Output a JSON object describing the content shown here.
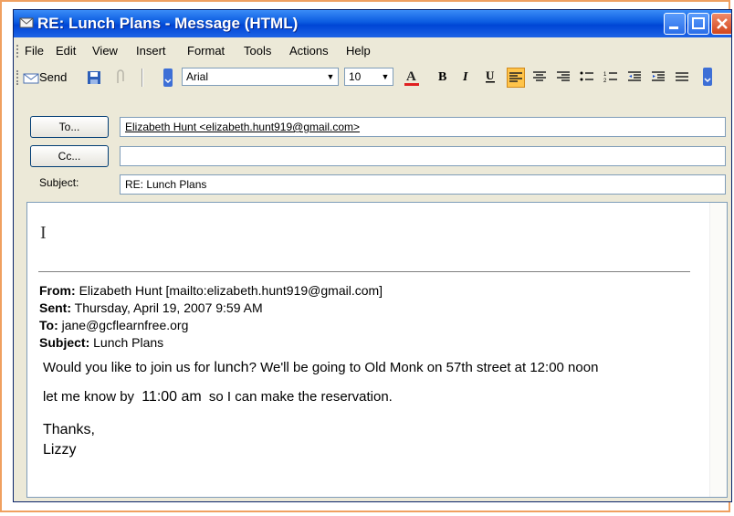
{
  "window": {
    "title": "RE: Lunch Plans - Message (HTML)"
  },
  "menu": [
    "File",
    "Edit",
    "View",
    "Insert",
    "Format",
    "Tools",
    "Actions",
    "Help"
  ],
  "toolbar": {
    "send_label": "Send",
    "font": "Arial",
    "size": "10"
  },
  "fields": {
    "to_button": "To...",
    "cc_button": "Cc...",
    "subject_label": "Subject:",
    "to_value": "Elizabeth Hunt <elizabeth.hunt919@gmail.com>",
    "cc_value": "",
    "subject_value": "RE: Lunch Plans"
  },
  "quoted": {
    "from_label": "From:",
    "from_value": "Elizabeth Hunt [mailto:elizabeth.hunt919@gmail.com]",
    "sent_label": "Sent:",
    "sent_value": "Thursday, April 19, 2007 9:59 AM",
    "to_label": "To:",
    "to_value": "jane@gcflearnfree.org",
    "subject_label": "Subject:",
    "subject_value": "Lunch Plans"
  },
  "message": {
    "line1_a": "Would you like to join us for",
    "line1_b": "lunch",
    "line1_c": "? We'll be going to Old Monk on 57th street at 12:00 noon",
    "line2_a": "let me know by",
    "line2_b": "11:00 am",
    "line2_c": "so I can make the reservation.",
    "closing": "Thanks,",
    "signature": "Lizzy"
  },
  "colors": {
    "titlebar": "#0a5ae0",
    "highlight_border": "#f0a060"
  }
}
